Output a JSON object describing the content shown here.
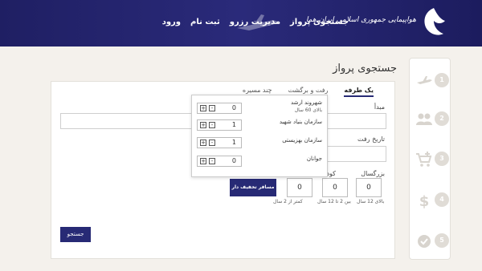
{
  "header": {
    "nav": [
      "جستجوی پرواز",
      "مدیریت رزرو",
      "ثبت نام",
      "ورود"
    ],
    "logo_text": "هواپیمایی جمهوری اسلامی ایران هما"
  },
  "page_title": "جستجوی پرواز",
  "tabs": [
    "یک طرفه",
    "رفت و برگشت",
    "چند مسیره"
  ],
  "form": {
    "origin_label": "مبدأ",
    "date_label": "تاریخ رفت",
    "adult_label": "بزرگسال",
    "child_label": "کودک",
    "adult_value": "0",
    "child_value": "0",
    "infant_value": "0",
    "adult_note": "بالای 12 سال",
    "child_note": "بین 2 تا 12 سال",
    "infant_note": "کمتر از 2 سال",
    "discount_button": "مسافر تخفیف دار",
    "search_button": "جستجو"
  },
  "popup": {
    "rows": [
      {
        "label": "شهروند ارشد",
        "sub": "بالای 60 سال",
        "value": "0"
      },
      {
        "label": "سازمان بنیاد شهید",
        "sub": "",
        "value": "1"
      },
      {
        "label": "سازمان بهزیستی",
        "sub": "",
        "value": "1"
      },
      {
        "label": "جوانان",
        "sub": "",
        "value": "0"
      }
    ],
    "plus": "+",
    "minus": "-"
  },
  "steps": [
    {
      "num": "1",
      "icon": "airplane-icon"
    },
    {
      "num": "2",
      "icon": "passengers-icon"
    },
    {
      "num": "3",
      "icon": "cart-add-icon"
    },
    {
      "num": "4",
      "icon": "dollar-icon"
    },
    {
      "num": "5",
      "icon": "check-icon"
    }
  ],
  "colors": {
    "primary": "#272a75",
    "header": "#23236b",
    "background": "#f4f1ec"
  }
}
